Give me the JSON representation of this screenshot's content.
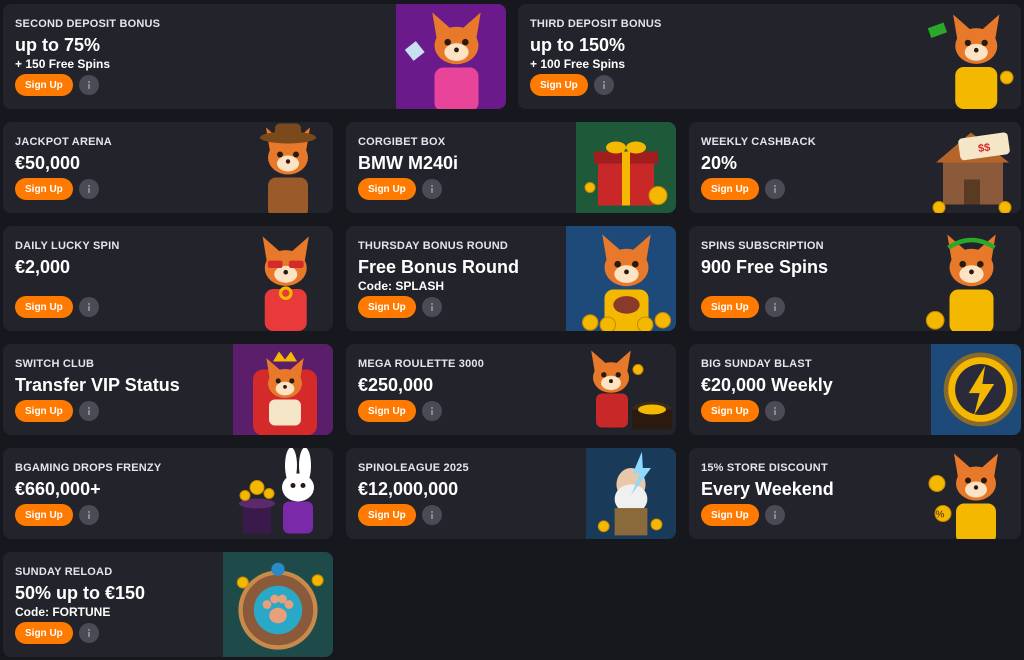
{
  "promotions": [
    {
      "kicker": "SECOND DEPOSIT BONUS",
      "headline": "up to 75%",
      "sub": "+ 150 Free Spins",
      "button": "Sign Up",
      "art": "fox-pink-dress-icon",
      "art_bg": "#6a1a8a",
      "art_accent": "#e8449a"
    },
    {
      "kicker": "THIRD DEPOSIT BONUS",
      "headline": "up to 150%",
      "sub": "+ 100 Free Spins",
      "button": "Sign Up",
      "art": "fox-money-icon",
      "art_bg": "#23242b",
      "art_accent": "#f5b800"
    },
    {
      "kicker": "JACKPOT ARENA",
      "headline": "€50,000",
      "sub": "",
      "button": "Sign Up",
      "art": "corgi-cowboy-icon",
      "art_bg": "#23242b",
      "art_accent": "#9a5a2a"
    },
    {
      "kicker": "CORGIBET BOX",
      "headline": "BMW M240i",
      "sub": "",
      "button": "Sign Up",
      "art": "gift-box-icon",
      "art_bg": "#1e5a3a",
      "art_accent": "#c82828"
    },
    {
      "kicker": "WEEKLY CASHBACK",
      "headline": "20%",
      "sub": "",
      "button": "Sign Up",
      "art": "cashback-house-icon",
      "art_bg": "#23242b",
      "art_accent": "#b5652a"
    },
    {
      "kicker": "DAILY LUCKY SPIN",
      "headline": "€2,000",
      "sub": "",
      "button": "Sign Up",
      "art": "corgi-sunglasses-icon",
      "art_bg": "#23242b",
      "art_accent": "#e83a3a"
    },
    {
      "kicker": "THURSDAY BONUS ROUND",
      "headline": "Free Bonus Round",
      "sub": "Code: SPLASH",
      "button": "Sign Up",
      "art": "corgi-coins-icon",
      "art_bg": "#1e4a7a",
      "art_accent": "#f5b800"
    },
    {
      "kicker": "SPINS SUBSCRIPTION",
      "headline": "900 Free Spins",
      "sub": "",
      "button": "Sign Up",
      "art": "corgi-toga-icon",
      "art_bg": "#23242b",
      "art_accent": "#f5b800"
    },
    {
      "kicker": "SWITCH CLUB",
      "headline": "Transfer VIP Status",
      "sub": "",
      "button": "Sign Up",
      "art": "corgi-throne-icon",
      "art_bg": "#5a1e6a",
      "art_accent": "#d42a2a"
    },
    {
      "kicker": "MEGA ROULETTE 3000",
      "headline": "€250,000",
      "sub": "",
      "button": "Sign Up",
      "art": "fox-roulette-icon",
      "art_bg": "#23242b",
      "art_accent": "#c82828"
    },
    {
      "kicker": "BIG SUNDAY BLAST",
      "headline": "€20,000 Weekly",
      "sub": "",
      "button": "Sign Up",
      "art": "lightning-coin-icon",
      "art_bg": "#1e4a7a",
      "art_accent": "#f5b800"
    },
    {
      "kicker": "BGAMING DROPS FRENZY",
      "headline": "€660,000+",
      "sub": "",
      "button": "Sign Up",
      "art": "rabbit-magician-icon",
      "art_bg": "#23242b",
      "art_accent": "#7a2aa8"
    },
    {
      "kicker": "SPINOLEAGUE 2025",
      "headline": "€12,000,000",
      "sub": "",
      "button": "Sign Up",
      "art": "zeus-icon",
      "art_bg": "#1a3a5a",
      "art_accent": "#8fd8ff"
    },
    {
      "kicker": "15% STORE DISCOUNT",
      "headline": "Every Weekend",
      "sub": "",
      "button": "Sign Up",
      "art": "fox-percent-icon",
      "art_bg": "#23242b",
      "art_accent": "#f5b800"
    },
    {
      "kicker": "SUNDAY RELOAD",
      "headline": "50% up to €150",
      "sub": "Code: FORTUNE",
      "button": "Sign Up",
      "art": "paw-amulet-icon",
      "art_bg": "#1e4a4a",
      "art_accent": "#2aa8c8"
    }
  ]
}
